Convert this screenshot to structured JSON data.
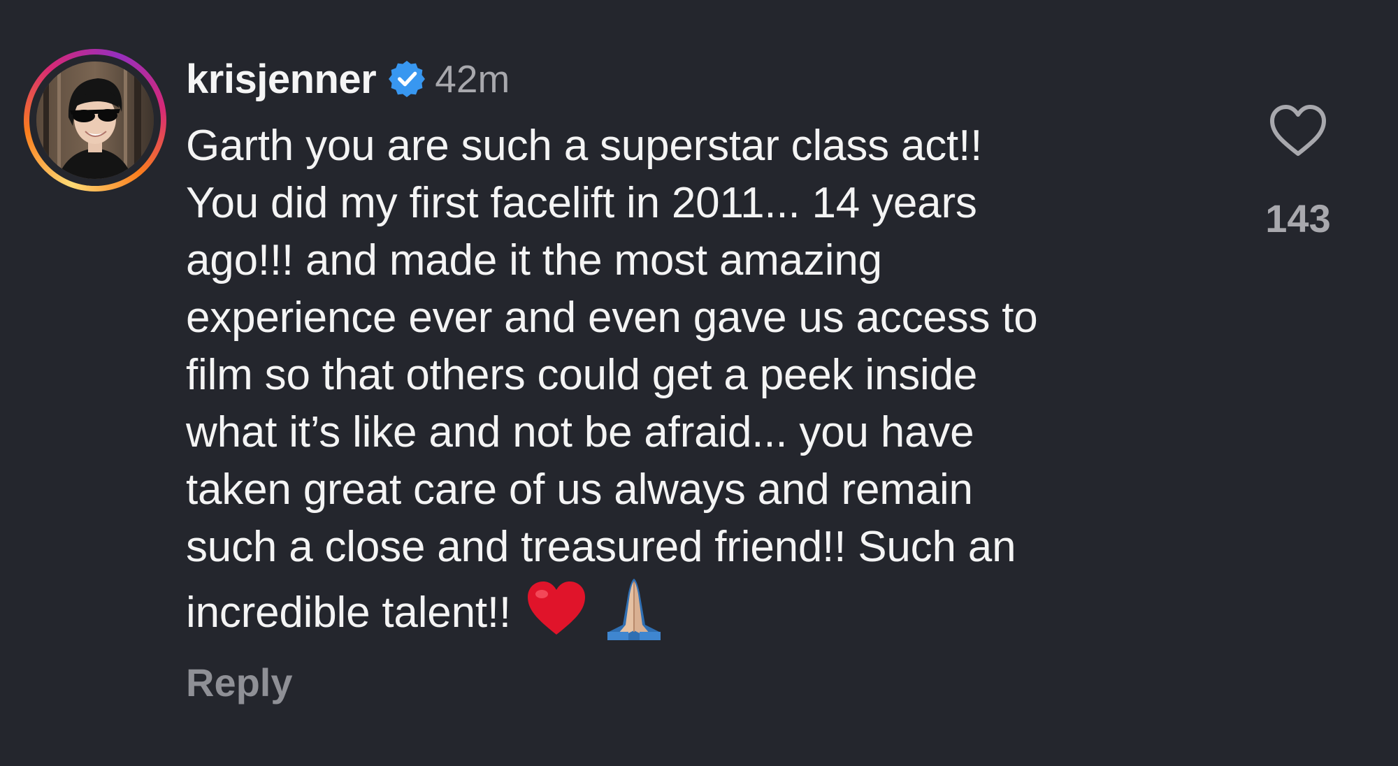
{
  "comment": {
    "username": "krisjenner",
    "verified": true,
    "timestamp": "42m",
    "text_lines": [
      "Garth you are such a superstar class act!!",
      "You did my first facelift in 2011... 14 years",
      "ago!!! and made it the most amazing",
      "experience ever and even gave us access to",
      "film so that others could get a peek inside",
      "what it’s like and not be afraid... you have",
      "taken great care of us always and remain",
      "such a close and treasured friend!! Such an",
      "incredible talent!!"
    ],
    "emojis": [
      "red-heart",
      "folded-hands-medium-light-skin"
    ],
    "reply_label": "Reply",
    "like_count": "143"
  },
  "colors": {
    "background": "#24262d",
    "text": "#f4f4f4",
    "muted": "#a8a8ad",
    "verified_blue": "#3897f0",
    "heart_red": "#e0142a"
  },
  "icons": {
    "verified": "verified-badge-icon",
    "like": "heart-outline-icon"
  }
}
